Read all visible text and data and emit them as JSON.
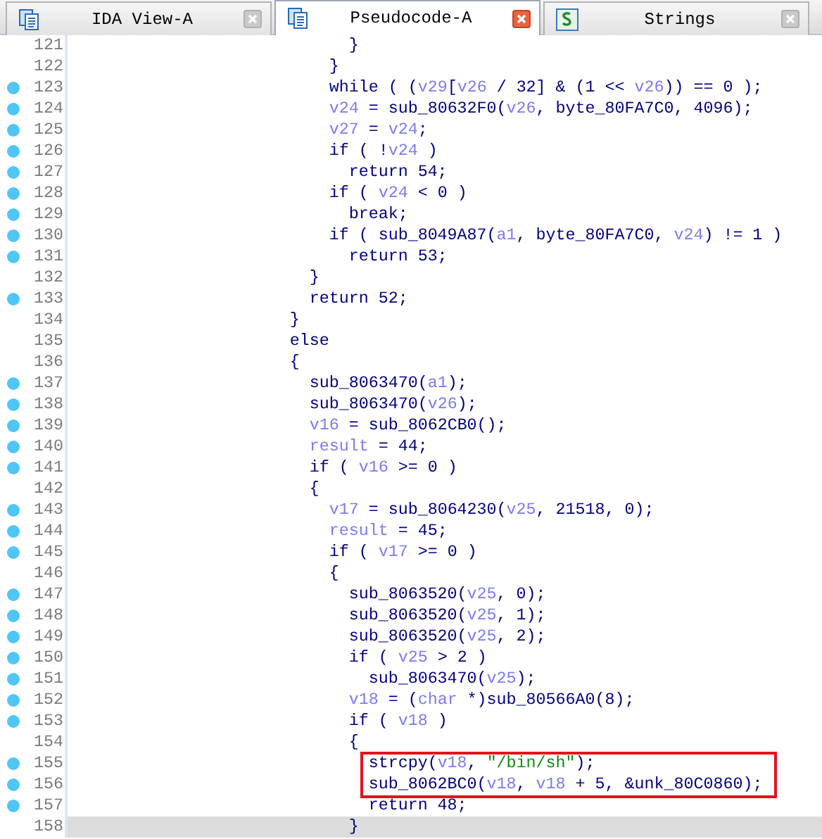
{
  "tabs": [
    {
      "label": "IDA View-A",
      "selected": false
    },
    {
      "label": "Pseudocode-A",
      "selected": true
    },
    {
      "label": "Strings",
      "selected": false
    }
  ],
  "lines": [
    {
      "number": "121",
      "marked": false,
      "selected": false,
      "boxed": false,
      "parts": [
        {
          "kind": "code",
          "text": "                            }"
        }
      ]
    },
    {
      "number": "122",
      "marked": false,
      "selected": false,
      "boxed": false,
      "parts": [
        {
          "kind": "code",
          "text": "                          }"
        }
      ]
    },
    {
      "number": "123",
      "marked": true,
      "selected": false,
      "boxed": false,
      "parts": [
        {
          "kind": "code",
          "text": "                          while ( ("
        },
        {
          "kind": "var",
          "text": "v29"
        },
        {
          "kind": "code",
          "text": "["
        },
        {
          "kind": "var",
          "text": "v26"
        },
        {
          "kind": "code",
          "text": " / 32] & (1 << "
        },
        {
          "kind": "var",
          "text": "v26"
        },
        {
          "kind": "code",
          "text": ")) == 0 );"
        }
      ]
    },
    {
      "number": "124",
      "marked": true,
      "selected": false,
      "boxed": false,
      "parts": [
        {
          "kind": "var",
          "text": "                          v24"
        },
        {
          "kind": "code",
          "text": " = sub_80632F0("
        },
        {
          "kind": "var",
          "text": "v26"
        },
        {
          "kind": "code",
          "text": ", byte_80FA7C0, 4096);"
        }
      ]
    },
    {
      "number": "125",
      "marked": true,
      "selected": false,
      "boxed": false,
      "parts": [
        {
          "kind": "var",
          "text": "                          v27"
        },
        {
          "kind": "code",
          "text": " = "
        },
        {
          "kind": "var",
          "text": "v24"
        },
        {
          "kind": "code",
          "text": ";"
        }
      ]
    },
    {
      "number": "126",
      "marked": true,
      "selected": false,
      "boxed": false,
      "parts": [
        {
          "kind": "code",
          "text": "                          if ( !"
        },
        {
          "kind": "var",
          "text": "v24"
        },
        {
          "kind": "code",
          "text": " )"
        }
      ]
    },
    {
      "number": "127",
      "marked": true,
      "selected": false,
      "boxed": false,
      "parts": [
        {
          "kind": "code",
          "text": "                            return 54;"
        }
      ]
    },
    {
      "number": "128",
      "marked": true,
      "selected": false,
      "boxed": false,
      "parts": [
        {
          "kind": "code",
          "text": "                          if ( "
        },
        {
          "kind": "var",
          "text": "v24"
        },
        {
          "kind": "code",
          "text": " < 0 )"
        }
      ]
    },
    {
      "number": "129",
      "marked": true,
      "selected": false,
      "boxed": false,
      "parts": [
        {
          "kind": "code",
          "text": "                            break;"
        }
      ]
    },
    {
      "number": "130",
      "marked": true,
      "selected": false,
      "boxed": false,
      "parts": [
        {
          "kind": "code",
          "text": "                          if ( sub_8049A87("
        },
        {
          "kind": "var",
          "text": "a1"
        },
        {
          "kind": "code",
          "text": ", byte_80FA7C0, "
        },
        {
          "kind": "var",
          "text": "v24"
        },
        {
          "kind": "code",
          "text": ") != 1 )"
        }
      ]
    },
    {
      "number": "131",
      "marked": true,
      "selected": false,
      "boxed": false,
      "parts": [
        {
          "kind": "code",
          "text": "                            return 53;"
        }
      ]
    },
    {
      "number": "132",
      "marked": false,
      "selected": false,
      "boxed": false,
      "parts": [
        {
          "kind": "code",
          "text": "                        }"
        }
      ]
    },
    {
      "number": "133",
      "marked": true,
      "selected": false,
      "boxed": false,
      "parts": [
        {
          "kind": "code",
          "text": "                        return 52;"
        }
      ]
    },
    {
      "number": "134",
      "marked": false,
      "selected": false,
      "boxed": false,
      "parts": [
        {
          "kind": "code",
          "text": "                      }"
        }
      ]
    },
    {
      "number": "135",
      "marked": false,
      "selected": false,
      "boxed": false,
      "parts": [
        {
          "kind": "code",
          "text": "                      else"
        }
      ]
    },
    {
      "number": "136",
      "marked": false,
      "selected": false,
      "boxed": false,
      "parts": [
        {
          "kind": "code",
          "text": "                      {"
        }
      ]
    },
    {
      "number": "137",
      "marked": true,
      "selected": false,
      "boxed": false,
      "parts": [
        {
          "kind": "code",
          "text": "                        sub_8063470("
        },
        {
          "kind": "var",
          "text": "a1"
        },
        {
          "kind": "code",
          "text": ");"
        }
      ]
    },
    {
      "number": "138",
      "marked": true,
      "selected": false,
      "boxed": false,
      "parts": [
        {
          "kind": "code",
          "text": "                        sub_8063470("
        },
        {
          "kind": "var",
          "text": "v26"
        },
        {
          "kind": "code",
          "text": ");"
        }
      ]
    },
    {
      "number": "139",
      "marked": true,
      "selected": false,
      "boxed": false,
      "parts": [
        {
          "kind": "var",
          "text": "                        v16"
        },
        {
          "kind": "code",
          "text": " = sub_8062CB0();"
        }
      ]
    },
    {
      "number": "140",
      "marked": true,
      "selected": false,
      "boxed": false,
      "parts": [
        {
          "kind": "var",
          "text": "                        result"
        },
        {
          "kind": "code",
          "text": " = 44;"
        }
      ]
    },
    {
      "number": "141",
      "marked": true,
      "selected": false,
      "boxed": false,
      "parts": [
        {
          "kind": "code",
          "text": "                        if ( "
        },
        {
          "kind": "var",
          "text": "v16"
        },
        {
          "kind": "code",
          "text": " >= 0 )"
        }
      ]
    },
    {
      "number": "142",
      "marked": false,
      "selected": false,
      "boxed": false,
      "parts": [
        {
          "kind": "code",
          "text": "                        {"
        }
      ]
    },
    {
      "number": "143",
      "marked": true,
      "selected": false,
      "boxed": false,
      "parts": [
        {
          "kind": "var",
          "text": "                          v17"
        },
        {
          "kind": "code",
          "text": " = sub_8064230("
        },
        {
          "kind": "var",
          "text": "v25"
        },
        {
          "kind": "code",
          "text": ", 21518, 0);"
        }
      ]
    },
    {
      "number": "144",
      "marked": true,
      "selected": false,
      "boxed": false,
      "parts": [
        {
          "kind": "var",
          "text": "                          result"
        },
        {
          "kind": "code",
          "text": " = 45;"
        }
      ]
    },
    {
      "number": "145",
      "marked": true,
      "selected": false,
      "boxed": false,
      "parts": [
        {
          "kind": "code",
          "text": "                          if ( "
        },
        {
          "kind": "var",
          "text": "v17"
        },
        {
          "kind": "code",
          "text": " >= 0 )"
        }
      ]
    },
    {
      "number": "146",
      "marked": false,
      "selected": false,
      "boxed": false,
      "parts": [
        {
          "kind": "code",
          "text": "                          {"
        }
      ]
    },
    {
      "number": "147",
      "marked": true,
      "selected": false,
      "boxed": false,
      "parts": [
        {
          "kind": "code",
          "text": "                            sub_8063520("
        },
        {
          "kind": "var",
          "text": "v25"
        },
        {
          "kind": "code",
          "text": ", 0);"
        }
      ]
    },
    {
      "number": "148",
      "marked": true,
      "selected": false,
      "boxed": false,
      "parts": [
        {
          "kind": "code",
          "text": "                            sub_8063520("
        },
        {
          "kind": "var",
          "text": "v25"
        },
        {
          "kind": "code",
          "text": ", 1);"
        }
      ]
    },
    {
      "number": "149",
      "marked": true,
      "selected": false,
      "boxed": false,
      "parts": [
        {
          "kind": "code",
          "text": "                            sub_8063520("
        },
        {
          "kind": "var",
          "text": "v25"
        },
        {
          "kind": "code",
          "text": ", 2);"
        }
      ]
    },
    {
      "number": "150",
      "marked": true,
      "selected": false,
      "boxed": false,
      "parts": [
        {
          "kind": "code",
          "text": "                            if ( "
        },
        {
          "kind": "var",
          "text": "v25"
        },
        {
          "kind": "code",
          "text": " > 2 )"
        }
      ]
    },
    {
      "number": "151",
      "marked": true,
      "selected": false,
      "boxed": false,
      "parts": [
        {
          "kind": "code",
          "text": "                              sub_8063470("
        },
        {
          "kind": "var",
          "text": "v25"
        },
        {
          "kind": "code",
          "text": ");"
        }
      ]
    },
    {
      "number": "152",
      "marked": true,
      "selected": false,
      "boxed": false,
      "parts": [
        {
          "kind": "var",
          "text": "                            v18"
        },
        {
          "kind": "code",
          "text": " = ("
        },
        {
          "kind": "var",
          "text": "char"
        },
        {
          "kind": "code",
          "text": " *)sub_80566A0(8);"
        }
      ]
    },
    {
      "number": "153",
      "marked": true,
      "selected": false,
      "boxed": false,
      "parts": [
        {
          "kind": "code",
          "text": "                            if ( "
        },
        {
          "kind": "var",
          "text": "v18"
        },
        {
          "kind": "code",
          "text": " )"
        }
      ]
    },
    {
      "number": "154",
      "marked": false,
      "selected": false,
      "boxed": false,
      "parts": [
        {
          "kind": "code",
          "text": "                            {"
        }
      ]
    },
    {
      "number": "155",
      "marked": true,
      "selected": false,
      "boxed": true,
      "parts": [
        {
          "kind": "code",
          "text": "                              strcpy("
        },
        {
          "kind": "var",
          "text": "v18"
        },
        {
          "kind": "code",
          "text": ", "
        },
        {
          "kind": "string",
          "text": "\"/bin/sh\""
        },
        {
          "kind": "code",
          "text": ");"
        }
      ]
    },
    {
      "number": "156",
      "marked": true,
      "selected": false,
      "boxed": true,
      "parts": [
        {
          "kind": "code",
          "text": "                              sub_8062BC0("
        },
        {
          "kind": "var",
          "text": "v18"
        },
        {
          "kind": "code",
          "text": ", "
        },
        {
          "kind": "var",
          "text": "v18"
        },
        {
          "kind": "code",
          "text": " + 5, &unk_80C0860);"
        }
      ]
    },
    {
      "number": "157",
      "marked": true,
      "selected": false,
      "boxed": false,
      "parts": [
        {
          "kind": "code",
          "text": "                              return 48;"
        }
      ]
    },
    {
      "number": "158",
      "marked": false,
      "selected": true,
      "boxed": false,
      "parts": [
        {
          "kind": "code",
          "text": "                            }"
        }
      ]
    }
  ]
}
